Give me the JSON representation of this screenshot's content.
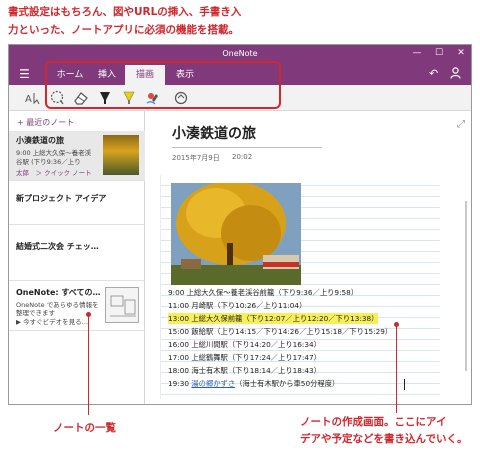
{
  "captions": {
    "top_line1": "書式設定はもちろん、図やURLの挿入、手書き入",
    "top_line2": "力といった、ノートアプリに必須の機能を搭載。",
    "bottom_left": "ノートの一覧",
    "bottom_right_line1": "ノートの作成画面。ここにアイ",
    "bottom_right_line2": "デアや予定などを書き込んでいく。"
  },
  "window": {
    "title": "OneNote",
    "minimize": "—",
    "maximize": "☐",
    "close": "✕"
  },
  "ribbon": {
    "tabs": [
      {
        "label": "ホーム",
        "active": false
      },
      {
        "label": "挿入",
        "active": false
      },
      {
        "label": "描画",
        "active": true
      },
      {
        "label": "表示",
        "active": false
      }
    ],
    "undo_icon": "↶",
    "account_icon": "👤"
  },
  "tools": [
    "select-icon",
    "lasso-icon",
    "eraser-icon",
    "pen-black-icon",
    "highlighter-icon",
    "pen-color-icon",
    "ink-to-shape-icon"
  ],
  "sidebar": {
    "add_page": "+ 最近のノート",
    "notes": [
      {
        "title": "小湊鉄道の旅",
        "line1": "9:00  上総大久保〜養老渓",
        "line2": "谷駅 (下り9:36／上り",
        "line3": "太郎　＞ クイック ノート"
      },
      {
        "title": "新プロジェクト アイデア"
      },
      {
        "title": "結婚式二次会 チェッ…"
      },
      {
        "title": "OneNote: すべての…",
        "line1": "OneNote であらゆる情報を",
        "line2": "整理できます",
        "line3": "▶ 今すぐビデオを見る…"
      }
    ]
  },
  "page": {
    "title": "小湊鉄道の旅",
    "date": "2015年7月9日",
    "time": "20:02",
    "schedule": [
      {
        "text": "9:00   上総大久保〜養老渓谷前籠（下り9:36／上り9:58）"
      },
      {
        "text": "11:00 月崎駅（下り10:26／上り11:04）"
      },
      {
        "text": "13:00 上総大久保前籠（下り12:07／上り12:20／下り13:38）",
        "highlight": true
      },
      {
        "text": "15:00 飯給駅（上り14:15／下り14:26／上り15:18／下り15:29）"
      },
      {
        "text": "16:00 上総川間駅（下り14:20／上り16:34）"
      },
      {
        "text": "17:00 上総鶴舞駅（下り17:24／上り17:47）"
      },
      {
        "text": "18:00 海士有木駅（下り18:14／上り18:43）"
      },
      {
        "text_prefix": "19:30 ",
        "link": "湯の郷かずさ",
        "text_suffix": "（海士有木駅から車50分程度）"
      }
    ]
  },
  "colors": {
    "brand": "#80397b",
    "caption_red": "#d0282e",
    "highlight_yellow": "#f6ef5a"
  }
}
